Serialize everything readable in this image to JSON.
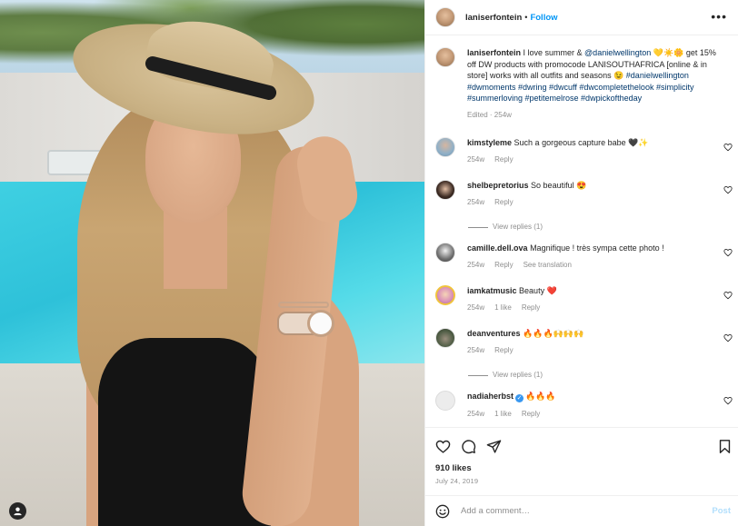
{
  "post": {
    "username": "laniserfontein",
    "follow_label": "Follow",
    "header_separator": "•",
    "more_label": "•••"
  },
  "caption": {
    "username": "laniserfontein",
    "text_1": " I love summer & ",
    "mention": "@danielwellington",
    "emoji_1": " 💛☀️🌼",
    "text_2": " get 15% off DW products with promocode LANISOUTHAFRICA [online & in store] works with all outfits and seasons ",
    "emoji_2": "😉 ",
    "hashtags": "#danielwellington #dwmoments #dwring #dwcuff #dwcompletethelook #simplicity #summerloving #petitemelrose #dwpickoftheday",
    "meta": "Edited · 254w"
  },
  "comments": [
    {
      "username": "kimstyleme",
      "text": "Such a gorgeous capture babe 🖤✨",
      "time": "254w",
      "likes": "",
      "reply": "Reply",
      "extra": "",
      "replies_label": ""
    },
    {
      "username": "shelbepretorius",
      "text": "So beautiful 😍",
      "time": "254w",
      "likes": "",
      "reply": "Reply",
      "extra": "",
      "replies_label": "View replies (1)"
    },
    {
      "username": "camille.dell.ova",
      "text": "Magnifique ! très sympa cette photo !",
      "time": "254w",
      "likes": "",
      "reply": "Reply",
      "extra": "See translation",
      "replies_label": ""
    },
    {
      "username": "iamkatmusic",
      "text": "Beauty ❤️",
      "time": "254w",
      "likes": "1 like",
      "reply": "Reply",
      "extra": "",
      "replies_label": ""
    },
    {
      "username": "deanventures",
      "text": "🔥🔥🔥🙌🙌🙌",
      "time": "254w",
      "likes": "",
      "reply": "Reply",
      "extra": "",
      "replies_label": "View replies (1)"
    },
    {
      "username": "nadiaherbst",
      "text": "🔥🔥🔥",
      "time": "254w",
      "likes": "1 like",
      "reply": "Reply",
      "extra": "",
      "replies_label": ""
    }
  ],
  "footer": {
    "likes": "910 likes",
    "date": "July 24, 2019",
    "comment_placeholder": "Add a comment…",
    "post_label": "Post"
  },
  "icons": {
    "like": "heart-icon",
    "comment": "comment-icon",
    "share": "paper-plane-icon",
    "save": "bookmark-icon",
    "emoji": "emoji-smile-icon",
    "tag": "user-tag-icon"
  },
  "colors": {
    "accent": "#0095f6",
    "link": "#00376b",
    "muted": "#8e8e8e",
    "verified": "#3897f0",
    "post_disabled": "#b2dffc"
  }
}
